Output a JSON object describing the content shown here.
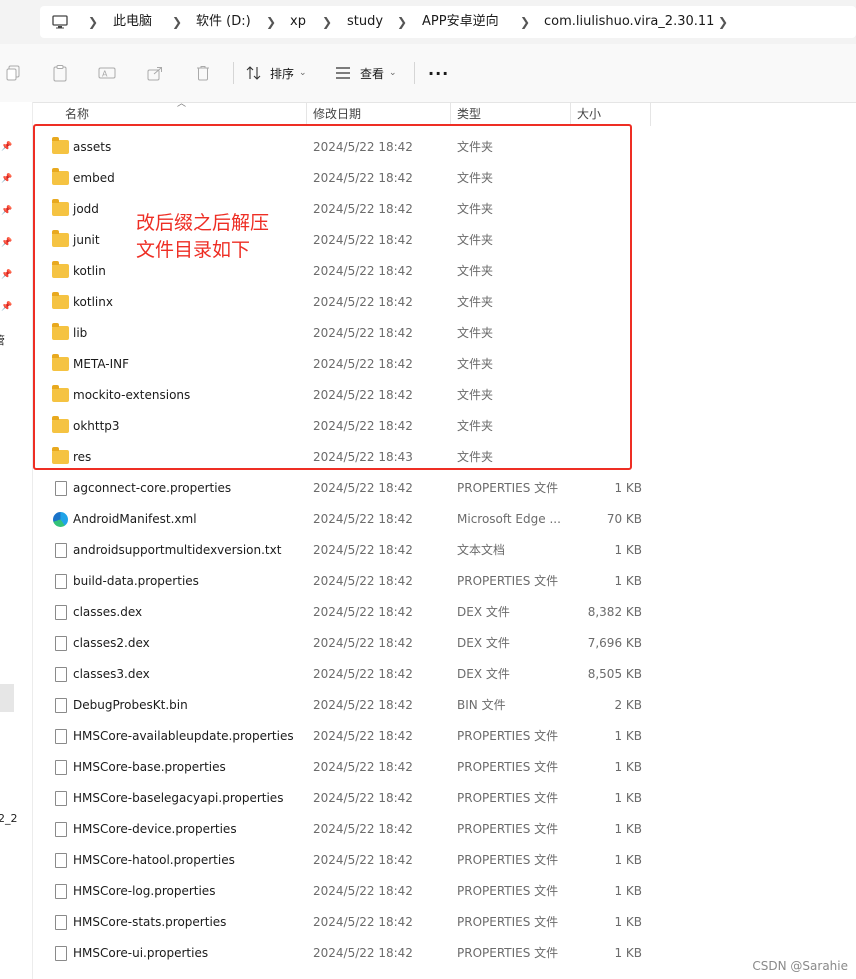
{
  "breadcrumb": {
    "items": [
      "此电脑",
      "软件 (D:)",
      "xp",
      "study",
      "APP安卓逆向",
      "com.liulishuo.vira_2.30.11"
    ]
  },
  "toolbar": {
    "sort_label": "排序",
    "view_label": "查看",
    "more_label": "···"
  },
  "columns": {
    "name": "名称",
    "date": "修改日期",
    "type": "类型",
    "size": "大小"
  },
  "nav": {
    "fragment_1": "管",
    "fragment_2": "2_2"
  },
  "rows": [
    {
      "name": "assets",
      "date": "2024/5/22 18:42",
      "type": "文件夹",
      "size": "",
      "kind": "folder"
    },
    {
      "name": "embed",
      "date": "2024/5/22 18:42",
      "type": "文件夹",
      "size": "",
      "kind": "folder"
    },
    {
      "name": "jodd",
      "date": "2024/5/22 18:42",
      "type": "文件夹",
      "size": "",
      "kind": "folder"
    },
    {
      "name": "junit",
      "date": "2024/5/22 18:42",
      "type": "文件夹",
      "size": "",
      "kind": "folder"
    },
    {
      "name": "kotlin",
      "date": "2024/5/22 18:42",
      "type": "文件夹",
      "size": "",
      "kind": "folder"
    },
    {
      "name": "kotlinx",
      "date": "2024/5/22 18:42",
      "type": "文件夹",
      "size": "",
      "kind": "folder"
    },
    {
      "name": "lib",
      "date": "2024/5/22 18:42",
      "type": "文件夹",
      "size": "",
      "kind": "folder"
    },
    {
      "name": "META-INF",
      "date": "2024/5/22 18:42",
      "type": "文件夹",
      "size": "",
      "kind": "folder"
    },
    {
      "name": "mockito-extensions",
      "date": "2024/5/22 18:42",
      "type": "文件夹",
      "size": "",
      "kind": "folder"
    },
    {
      "name": "okhttp3",
      "date": "2024/5/22 18:42",
      "type": "文件夹",
      "size": "",
      "kind": "folder"
    },
    {
      "name": "res",
      "date": "2024/5/22 18:43",
      "type": "文件夹",
      "size": "",
      "kind": "folder"
    },
    {
      "name": "agconnect-core.properties",
      "date": "2024/5/22 18:42",
      "type": "PROPERTIES 文件",
      "size": "1 KB",
      "kind": "file"
    },
    {
      "name": "AndroidManifest.xml",
      "date": "2024/5/22 18:42",
      "type": "Microsoft Edge ...",
      "size": "70 KB",
      "kind": "edge"
    },
    {
      "name": "androidsupportmultidexversion.txt",
      "date": "2024/5/22 18:42",
      "type": "文本文档",
      "size": "1 KB",
      "kind": "file"
    },
    {
      "name": "build-data.properties",
      "date": "2024/5/22 18:42",
      "type": "PROPERTIES 文件",
      "size": "1 KB",
      "kind": "file"
    },
    {
      "name": "classes.dex",
      "date": "2024/5/22 18:42",
      "type": "DEX 文件",
      "size": "8,382 KB",
      "kind": "file"
    },
    {
      "name": "classes2.dex",
      "date": "2024/5/22 18:42",
      "type": "DEX 文件",
      "size": "7,696 KB",
      "kind": "file"
    },
    {
      "name": "classes3.dex",
      "date": "2024/5/22 18:42",
      "type": "DEX 文件",
      "size": "8,505 KB",
      "kind": "file"
    },
    {
      "name": "DebugProbesKt.bin",
      "date": "2024/5/22 18:42",
      "type": "BIN 文件",
      "size": "2 KB",
      "kind": "file"
    },
    {
      "name": "HMSCore-availableupdate.properties",
      "date": "2024/5/22 18:42",
      "type": "PROPERTIES 文件",
      "size": "1 KB",
      "kind": "file"
    },
    {
      "name": "HMSCore-base.properties",
      "date": "2024/5/22 18:42",
      "type": "PROPERTIES 文件",
      "size": "1 KB",
      "kind": "file"
    },
    {
      "name": "HMSCore-baselegacyapi.properties",
      "date": "2024/5/22 18:42",
      "type": "PROPERTIES 文件",
      "size": "1 KB",
      "kind": "file"
    },
    {
      "name": "HMSCore-device.properties",
      "date": "2024/5/22 18:42",
      "type": "PROPERTIES 文件",
      "size": "1 KB",
      "kind": "file"
    },
    {
      "name": "HMSCore-hatool.properties",
      "date": "2024/5/22 18:42",
      "type": "PROPERTIES 文件",
      "size": "1 KB",
      "kind": "file"
    },
    {
      "name": "HMSCore-log.properties",
      "date": "2024/5/22 18:42",
      "type": "PROPERTIES 文件",
      "size": "1 KB",
      "kind": "file"
    },
    {
      "name": "HMSCore-stats.properties",
      "date": "2024/5/22 18:42",
      "type": "PROPERTIES 文件",
      "size": "1 KB",
      "kind": "file"
    },
    {
      "name": "HMSCore-ui.properties",
      "date": "2024/5/22 18:42",
      "type": "PROPERTIES 文件",
      "size": "1 KB",
      "kind": "file"
    }
  ],
  "annotation": {
    "text": "改后缀之后解压\n文件目录如下",
    "color": "#ee2e24"
  },
  "watermark": "CSDN @Sarahie"
}
